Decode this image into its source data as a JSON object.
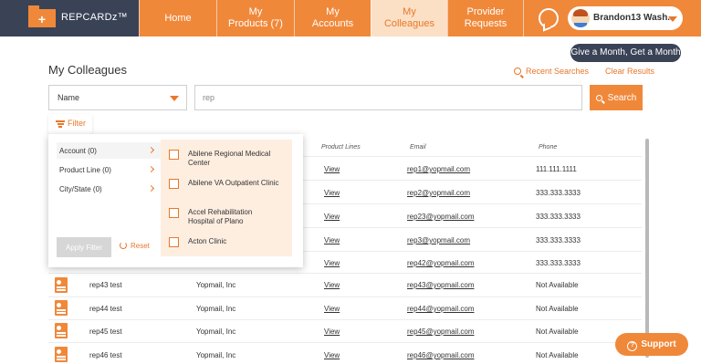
{
  "header": {
    "brand": "REPCARDz™",
    "brand_icon": "+",
    "tabs": [
      {
        "label": "Home"
      },
      {
        "label": "My\nProducts (7)"
      },
      {
        "label": "My\nAccounts"
      },
      {
        "label": "My\nColleagues"
      },
      {
        "label": "Provider\nRequests"
      }
    ],
    "user_name": "Brandon13 Wash..."
  },
  "promo": "Give a Month, Get a Month",
  "page_title": "My Colleagues",
  "recent_searches": "Recent Searches",
  "clear_results": "Clear Results",
  "search": {
    "field": "Name",
    "value": "rep",
    "button": "Search"
  },
  "filter_label": "Filter",
  "table": {
    "headers": [
      "Product Lines",
      "Email",
      "Phone"
    ],
    "rows": [
      {
        "name": "",
        "company": "",
        "products": "View",
        "email": "rep1@yopmail.com",
        "phone": "111.111.1111"
      },
      {
        "name": "",
        "company": "",
        "products": "View",
        "email": "rep2@yopmail.com",
        "phone": "333.333.3333"
      },
      {
        "name": "",
        "company": "",
        "products": "View",
        "email": "rep23@yopmail.com",
        "phone": "333.333.3333"
      },
      {
        "name": "",
        "company": "",
        "products": "View",
        "email": "rep3@yopmail.com",
        "phone": "333.333.3333"
      },
      {
        "name": "",
        "company": "",
        "products": "View",
        "email": "rep42@yopmail.com",
        "phone": "333.333.3333"
      },
      {
        "name": "rep43 test",
        "company": "Yopmail, Inc",
        "products": "View",
        "email": "rep43@yopmail.com",
        "phone": "Not Available"
      },
      {
        "name": "rep44 test",
        "company": "Yopmail, Inc",
        "products": "View",
        "email": "rep44@yopmail.com",
        "phone": "Not Available"
      },
      {
        "name": "rep45 test",
        "company": "Yopmail, Inc",
        "products": "View",
        "email": "rep45@yopmail.com",
        "phone": "Not Available"
      },
      {
        "name": "rep46 test",
        "company": "Yopmail, Inc",
        "products": "View",
        "email": "rep46@yopmail.com",
        "phone": "Not Available"
      }
    ]
  },
  "filter_panel": {
    "categories": [
      "Account (0)",
      "Product Line (0)",
      "City/State (0)"
    ],
    "options": [
      "Abilene Regional Medical Center",
      "Abilene VA Outpatient Clinic",
      "Accel Rehabilitation Hospital of Plano",
      "Acton Clinic"
    ],
    "apply": "Apply Filter",
    "reset": "Reset"
  },
  "support": "Support",
  "colors": {
    "accent": "#f0883a",
    "navy": "#3a4356",
    "active_tab_bg": "#fbe0c6"
  }
}
